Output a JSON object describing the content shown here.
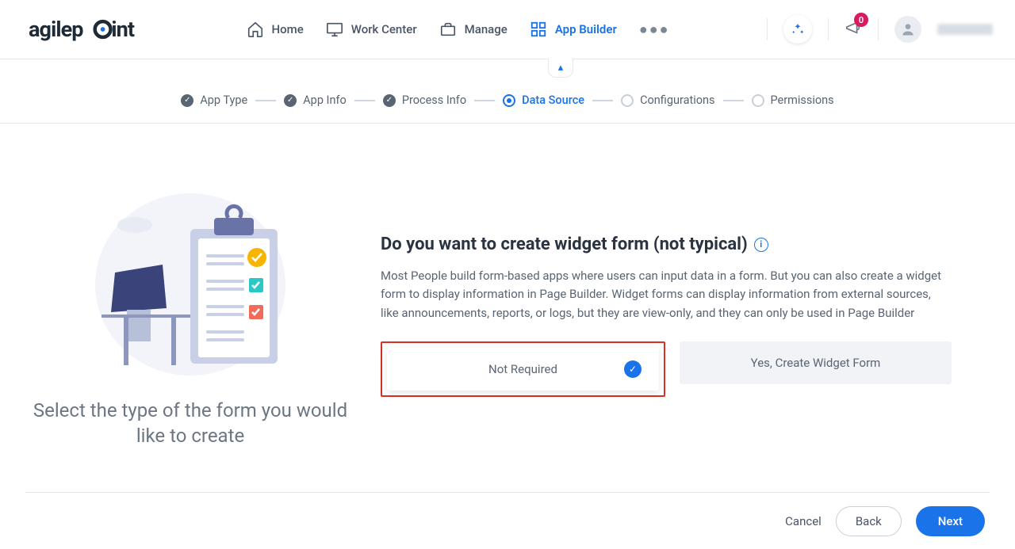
{
  "brand": "agilepoint",
  "nav": {
    "items": [
      {
        "label": "Home",
        "icon": "home-icon",
        "active": false
      },
      {
        "label": "Work Center",
        "icon": "monitor-icon",
        "active": false
      },
      {
        "label": "Manage",
        "icon": "briefcase-icon",
        "active": false
      },
      {
        "label": "App Builder",
        "icon": "grid-icon",
        "active": true
      }
    ],
    "notification_count": "0"
  },
  "stepper": {
    "steps": [
      {
        "label": "App Type",
        "state": "done"
      },
      {
        "label": "App Info",
        "state": "done"
      },
      {
        "label": "Process Info",
        "state": "done"
      },
      {
        "label": "Data Source",
        "state": "active"
      },
      {
        "label": "Configurations",
        "state": "pending"
      },
      {
        "label": "Permissions",
        "state": "pending"
      }
    ]
  },
  "left": {
    "caption": "Select the type of the form you would like to create"
  },
  "main": {
    "question": "Do you want to create widget form (not typical)",
    "description": "Most People build form-based apps where users can input data in a form. But you can also create a widget form to display information in Page Builder. Widget forms can display information from external sources, like announcements, reports, or logs, but they are view-only, and they can only be used in Page Builder",
    "options": {
      "not_required": "Not Required",
      "yes_widget": "Yes, Create Widget Form"
    }
  },
  "footer": {
    "cancel": "Cancel",
    "back": "Back",
    "next": "Next"
  }
}
